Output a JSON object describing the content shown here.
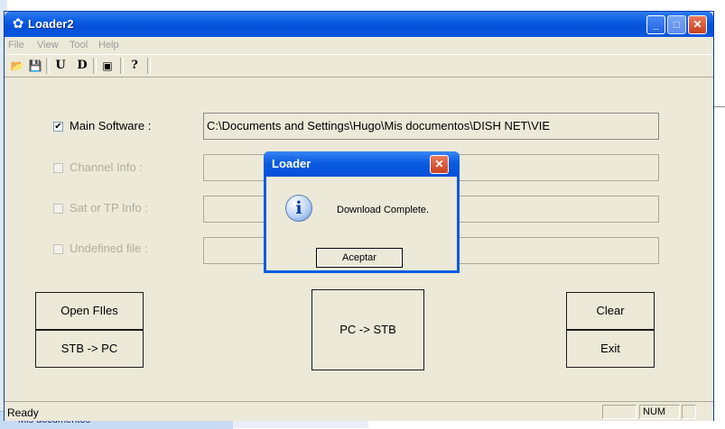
{
  "window": {
    "title": "Loader2",
    "menu": [
      "File",
      "View",
      "Tool",
      "Help"
    ],
    "toolbar_icons": [
      "open-folder-icon",
      "save-icon",
      "upload-u-icon",
      "download-d-icon",
      "image-icon",
      "help-question-icon"
    ],
    "toolbar_glyphs": [
      "📂",
      "💾",
      "U",
      "D",
      "▣",
      "?"
    ]
  },
  "rows": [
    {
      "label": "Main Software :",
      "checked": true,
      "enabled": true,
      "path": "C:\\Documents and Settings\\Hugo\\Mis documentos\\DISH NET\\VIE"
    },
    {
      "label": "Channel Info :",
      "checked": false,
      "enabled": false,
      "path": ""
    },
    {
      "label": "Sat or TP Info :",
      "checked": false,
      "enabled": false,
      "path": ""
    },
    {
      "label": "Undefined file :",
      "checked": false,
      "enabled": false,
      "path": ""
    }
  ],
  "buttons": {
    "open_files": "Open FIles",
    "stb_to_pc": "STB -> PC",
    "pc_to_stb": "PC -> STB",
    "clear": "Clear",
    "exit": "Exit"
  },
  "status": {
    "text": "Ready",
    "num": "NUM"
  },
  "dialog": {
    "title": "Loader",
    "message": "Download Complete.",
    "ok": "Aceptar"
  },
  "background": {
    "taskbar_text": "Mis documentos"
  },
  "colors": {
    "title_blue": "#0a5ce0",
    "face": "#ece9d8",
    "close_red": "#c8401f"
  }
}
